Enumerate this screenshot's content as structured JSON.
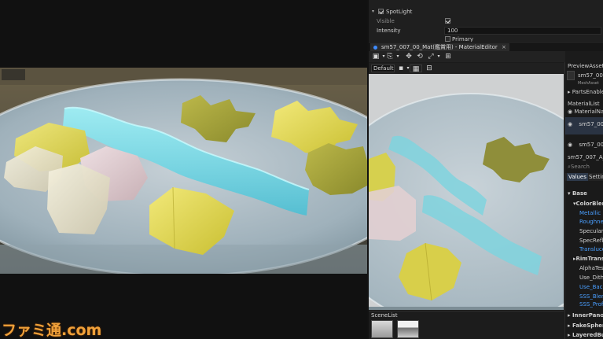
{
  "props": {
    "spotlight_label": "SpotLight",
    "visible_label": "Visible",
    "intensity_label": "Intensity",
    "intensity_value": "100",
    "primary_label": "Primary"
  },
  "editor_tab": {
    "label": "sm57_007_00_Mat(鑑賞用) - MaterialEditor",
    "close": "×"
  },
  "toolbar": {
    "view_mode": "Default"
  },
  "scenelist": {
    "title": "SceneList"
  },
  "side": {
    "preview_asset": "PreviewAsset",
    "asset_name": "sm57_007",
    "mesh_asset": "MeshAsset",
    "parts_enable": "PartsEnable",
    "material_list": "MaterialList",
    "material_name": "MaterialName",
    "mat_item_1": "sm57_007",
    "mat_item_2": "sm57_007",
    "selected_mat": "sm57_007_A_Mat",
    "search_placeholder": "Search",
    "tab_values": "Values",
    "tab_settings": "Setting",
    "base": "Base",
    "color_blend": "ColorBlend",
    "metallic": "Metallic",
    "roughness": "Roughness",
    "specular": "SpecularRe",
    "spec_reflect": "SpecReflec",
    "translucent": "Translucent",
    "rim_trans": "RimTransl",
    "alpha_test": "AlphaTestR",
    "use_dither": "Use_Dither",
    "use_back": "Use_Back",
    "sss_blend": "SSS_Blend",
    "sss_profile": "SSS_Profil",
    "inner_panorama": "InnerPanoram",
    "fake_sphere": "FakeSphere",
    "layered_bump": "LayeredBump"
  },
  "watermark": "ファミ通.com",
  "colors": {
    "accent_blue": "#4a9fff",
    "jelly_blue": "#6fd6e6",
    "jelly_yellow": "#d8cf4a",
    "jelly_pink": "#e2c8cc",
    "watermark": "#f0a13a"
  }
}
